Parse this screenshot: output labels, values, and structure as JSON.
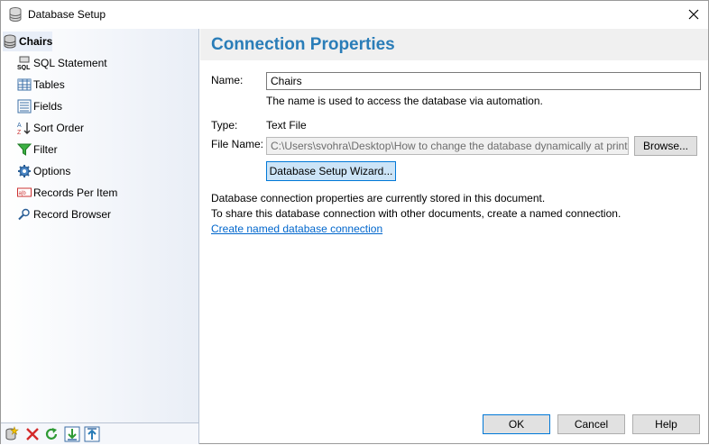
{
  "window": {
    "title": "Database Setup"
  },
  "sidebar": {
    "items": [
      {
        "label": "Chairs"
      },
      {
        "label": "SQL Statement"
      },
      {
        "label": "Tables"
      },
      {
        "label": "Fields"
      },
      {
        "label": "Sort Order"
      },
      {
        "label": "Filter"
      },
      {
        "label": "Options"
      },
      {
        "label": "Records Per Item"
      },
      {
        "label": "Record Browser"
      }
    ]
  },
  "main": {
    "heading": "Connection Properties",
    "name_label": "Name:",
    "name_value": "Chairs",
    "name_hint": "The name is used to access the database via automation.",
    "type_label": "Type:",
    "type_value": "Text File",
    "file_label": "File Name:",
    "file_value": "C:\\Users\\svohra\\Desktop\\How to change the database dynamically at print",
    "browse_label": "Browse...",
    "wizard_label": "Database Setup Wizard...",
    "info_line1": "Database connection properties are currently stored in this document.",
    "info_line2": "To share this database connection with other documents, create a named connection.",
    "link_label": "Create named database connection"
  },
  "footer": {
    "ok_label": "OK",
    "cancel_label": "Cancel",
    "help_label": "Help"
  },
  "colors": {
    "heading": "#2a7db8",
    "link": "#0066cc",
    "accent": "#0078d7"
  }
}
